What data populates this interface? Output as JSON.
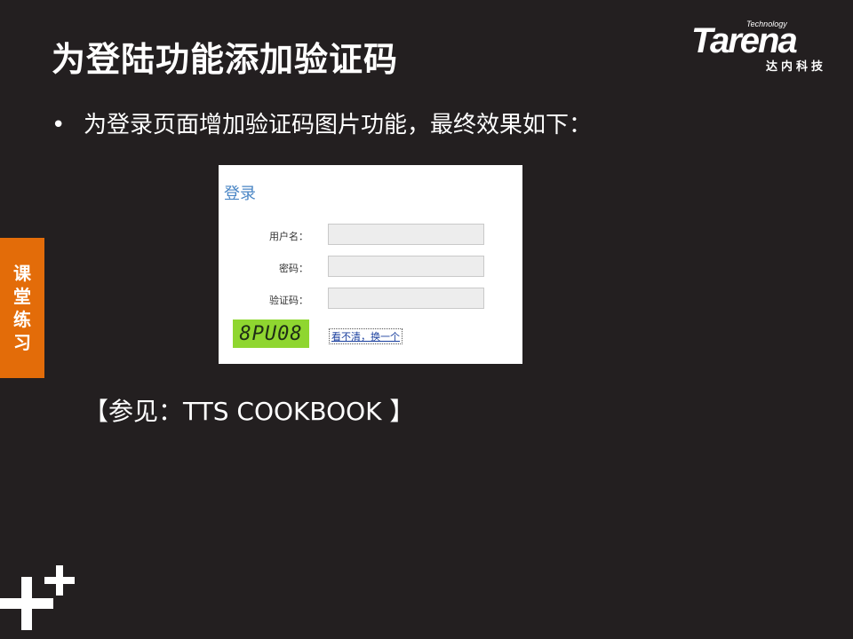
{
  "slide": {
    "title": "为登陆功能添加验证码",
    "bullet_marker": "•",
    "bullet_text": "为登录页面增加验证码图片功能，最终效果如下：",
    "reference": "【参见：TTS COOKBOOK 】",
    "side_tab_chars": [
      "课",
      "堂",
      "练",
      "习"
    ]
  },
  "logo": {
    "tagline": "Technology",
    "wordmark": "Tarena",
    "chinese": "达内科技"
  },
  "login_form": {
    "title": "登录",
    "username_label": "用户名：",
    "password_label": "密码：",
    "captcha_label": "验证码：",
    "captcha_text": "8PU08",
    "refresh_link": "看不清，换一个"
  },
  "colors": {
    "background": "#231f20",
    "side_tab": "#e36c09",
    "captcha_bg": "#8fd630",
    "form_title": "#4a86c5"
  },
  "icons": [
    "plus-decoration-icon"
  ]
}
